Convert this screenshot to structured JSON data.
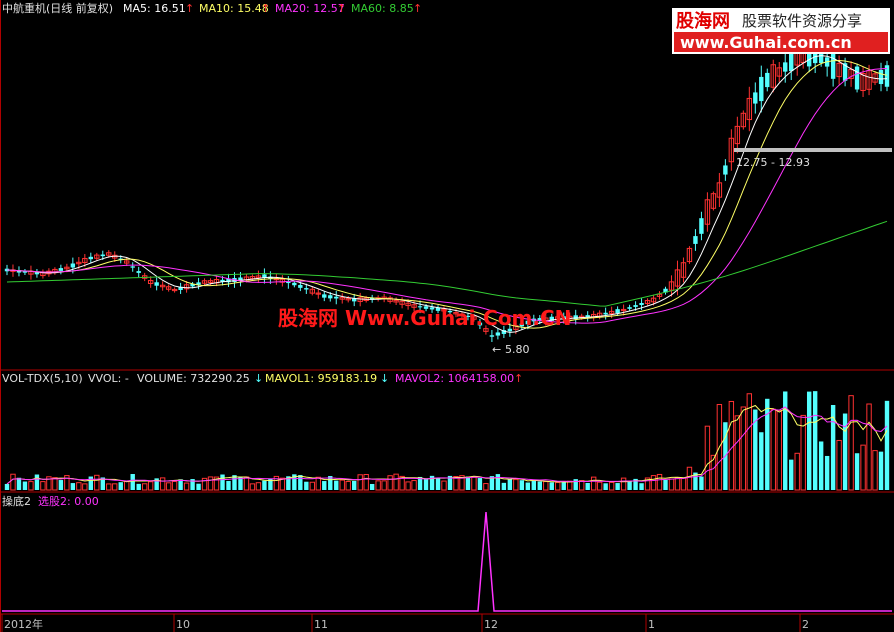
{
  "header": {
    "stock_title": "中航重机(日线 前复权)",
    "ma_labels": [
      {
        "text": "MA5: 16.51",
        "color": "#ffffff"
      },
      {
        "text": "MA10: 15.48",
        "color": "#ffff66"
      },
      {
        "text": "MA20: 12.57",
        "color": "#ff33ff"
      },
      {
        "text": "MA60: 8.85",
        "color": "#33cc33"
      }
    ],
    "arrow_up": "↑",
    "arrow_down": "↓"
  },
  "watermark": {
    "logo_text": "股海网",
    "slogan": "股票软件资源分享",
    "url": "www.Guhai.com.cn",
    "center_text": "股海网 Www.Guhai.Com.CN"
  },
  "annotations": {
    "low_price": "5.80",
    "resistance": "12.75 - 12.93"
  },
  "volume_panel": {
    "title": "VOL-TDX(5,10)",
    "vvol": "VVOL: -",
    "volume": "VOLUME: 732290.25",
    "mavol1": "MAVOL1: 959183.19",
    "mavol2": "MAVOL2: 1064158.00"
  },
  "indicator_panel": {
    "title": "操底2",
    "value": "选股2: 0.00"
  },
  "x_axis": {
    "labels": [
      "2012年",
      "10",
      "11",
      "12",
      "1",
      "2"
    ]
  },
  "colors": {
    "up": "#ff3232",
    "down": "#54ffff",
    "ma5": "#ffffff",
    "ma10": "#ffff66",
    "ma20": "#ff33ff",
    "ma60": "#33cc33",
    "frame": "#b00000",
    "watermark_red": "#ff1a1a",
    "indicator": "#ff33ff"
  },
  "chart_data": {
    "type": "candlestick",
    "price_points": {
      "low": 5.8,
      "resistance_low": 12.75,
      "resistance_high": 12.93
    },
    "moving_averages_last": {
      "MA5": 16.51,
      "MA10": 15.48,
      "MA20": 12.57,
      "MA60": 8.85
    },
    "volume_last": {
      "VOLUME": 732290.25,
      "MAVOL1": 959183.19,
      "MAVOL2": 1064158.0
    },
    "indicator_last": {
      "选股2": 0.0
    },
    "x_ticks": [
      "2012年",
      "10",
      "11",
      "12",
      "1",
      "2"
    ]
  }
}
